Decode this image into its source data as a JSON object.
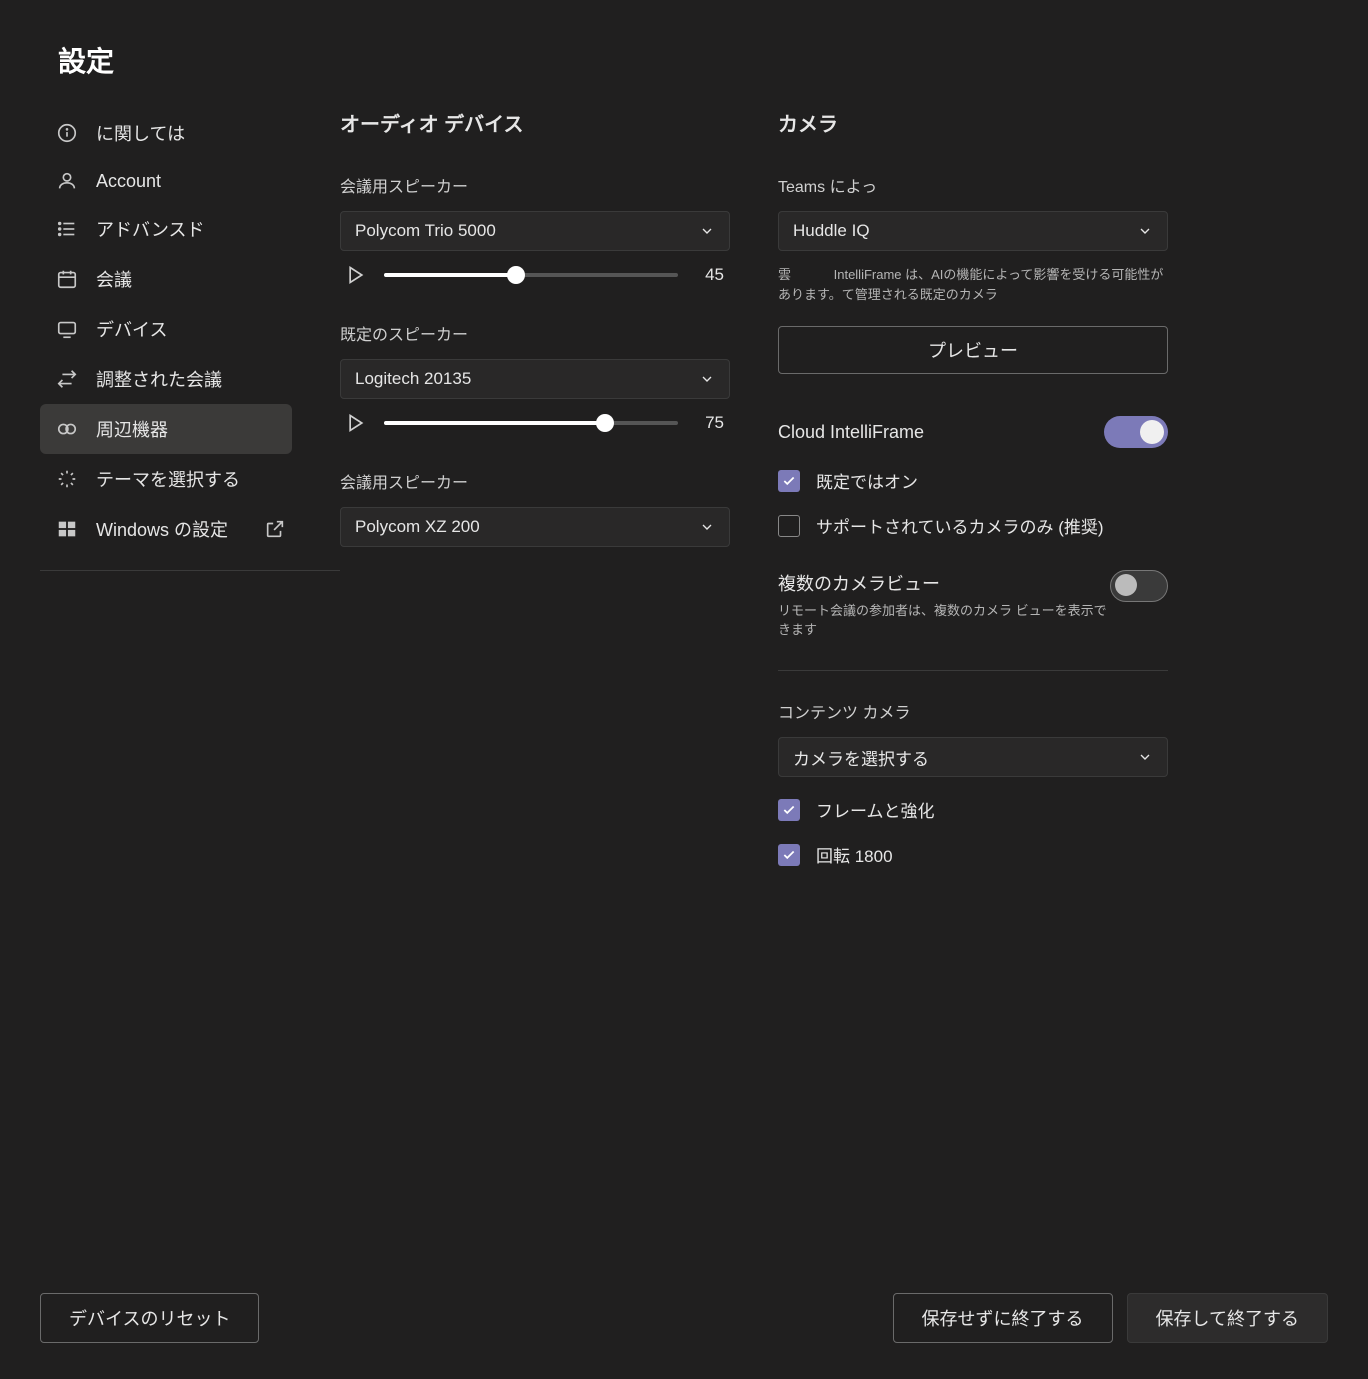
{
  "title": "設定",
  "sidebar": {
    "items": [
      {
        "label": "に関しては",
        "icon": "info"
      },
      {
        "label": "Account",
        "icon": "account"
      },
      {
        "label": "アドバンスド",
        "icon": "list"
      },
      {
        "label": "会議",
        "icon": "calendar"
      },
      {
        "label": "デバイス",
        "icon": "monitor"
      },
      {
        "label": "調整された会議",
        "icon": "swap"
      },
      {
        "label": "周辺機器",
        "icon": "peripherals",
        "selected": true
      },
      {
        "label": "テーマを選択する",
        "icon": "theme"
      },
      {
        "label": "Windows の設定",
        "icon": "windows",
        "external": true
      }
    ]
  },
  "audio": {
    "section_title": "オーディオ デバイス",
    "meeting_speaker": {
      "label": "会議用スピーカー",
      "value": "Polycom Trio 5000",
      "volume": 45
    },
    "default_speaker": {
      "label": "既定のスピーカー",
      "value": "Logitech 20135",
      "volume": 75
    },
    "meeting_speaker2": {
      "label": "会議用スピーカー",
      "value": "Polycom XZ 200"
    }
  },
  "camera": {
    "section_title": "カメラ",
    "teams_label": "Teams によっ",
    "teams_value": "Huddle IQ",
    "note": "雲 　　　IntelliFrame は、AIの機能によって影響を受ける可能性があります。て管理される既定のカメラ",
    "preview_label": "プレビュー",
    "intelliframe": {
      "title": "Cloud IntelliFrame",
      "on": true,
      "default_on_label": "既定ではオン",
      "default_on_checked": true,
      "supported_only_label": "サポートされているカメラのみ (推奨)",
      "supported_only_checked": false
    },
    "multi_view": {
      "title": "複数のカメラビュー",
      "sub": "リモート会議の参加者は、複数のカメラ ビューを表示できます",
      "on": false
    },
    "content_camera": {
      "label": "コンテンツ カメラ",
      "value": "カメラを選択する",
      "frame_enhance_label": "フレームと強化",
      "frame_enhance_checked": true,
      "rotate_label": "回転 1800",
      "rotate_checked": true
    }
  },
  "footer": {
    "reset": "デバイスのリセット",
    "exit_no_save": "保存せずに終了する",
    "save_exit": "保存して終了する"
  }
}
